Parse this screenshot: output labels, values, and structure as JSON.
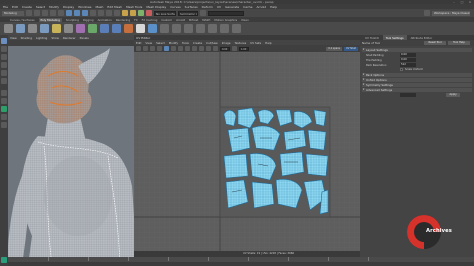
{
  "window": {
    "title": "Autodesk Maya 2018: C:\\Users\\projects\\uv_layout\\scenes\\character_uv.mb - persp"
  },
  "menubar": {
    "items": [
      "File",
      "Edit",
      "Create",
      "Select",
      "Modify",
      "Display",
      "Windows",
      "Mesh",
      "Edit Mesh",
      "Mesh Tools",
      "Mesh Display",
      "Curves",
      "Surfaces",
      "Deform",
      "UV",
      "Generate",
      "Cache",
      "Arnold",
      "Help"
    ]
  },
  "toolbar": {
    "workspace_value": "Modeling",
    "live_surface": "No Live Surface",
    "symmetry": "Symmetry: Off",
    "workspace_label": "Workspace : Maya Classic"
  },
  "shelf": {
    "tabs": [
      "Curves / Surfaces",
      "Poly Modeling",
      "Sculpting",
      "Rigging",
      "Animation",
      "Rendering",
      "FX",
      "FX Caching",
      "Custom",
      "Arnold",
      "Bifrost",
      "MASH",
      "Motion Graphics",
      "XGen"
    ],
    "active_tab": "Poly Modeling"
  },
  "viewport3d": {
    "menu": [
      "View",
      "Shading",
      "Lighting",
      "Show",
      "Renderer",
      "Panels"
    ]
  },
  "uv_editor": {
    "title": "UV Editor",
    "menu": [
      "Edit",
      "View",
      "Select",
      "Modify",
      "Tools",
      "Create",
      "Cut/Sew",
      "Image",
      "Textures",
      "UV Sets",
      "Help"
    ],
    "uv_space_label": "0-1 space",
    "shell_label": "UV Shell",
    "status_text": "UV Shells: 19 | UVs: 4218 | Faces: 3966"
  },
  "uv_toolkit": {
    "tabs": [
      "UV Toolkit",
      "Tool Settings",
      "Attribute Editor"
    ],
    "active_tab": "UV Toolkit",
    "header_label": "Name of Tool",
    "reset_button": "Reset Tool",
    "help_button": "Tool Help",
    "sections": {
      "layout": "Layout Settings",
      "pack": "Pack Options",
      "unfold": "Unfold Options",
      "symmetry": "Symmetry Settings",
      "advanced": "Advanced Settings"
    },
    "fields": [
      {
        "label": "Shell Padding",
        "value": "0.00"
      },
      {
        "label": "Tile Padding",
        "value": "0.00"
      },
      {
        "label": "Pack Resolution",
        "value": "512"
      }
    ],
    "checkbox_label": "Scale Uniform",
    "apply_button": "Apply"
  },
  "watermark": {
    "text": "Archives"
  },
  "colors": {
    "uv_shell_fill": "#8fd8f0",
    "uv_shell_edge": "#2a7fb0",
    "grid_bg": "#5c5c5c",
    "watermark_red": "#d6322c"
  }
}
